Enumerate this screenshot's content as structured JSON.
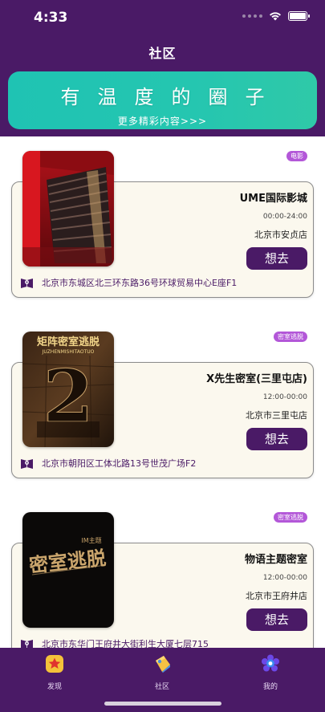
{
  "status": {
    "time": "4:33"
  },
  "nav": {
    "title": "社区"
  },
  "banner": {
    "title": "有温度的圈子",
    "subtitle": "更多精彩内容>>>",
    "color": "#1fc3b3"
  },
  "colors": {
    "brand": "#4a1a66",
    "tag": "#b357d8",
    "card_bg": "#fbf8ee"
  },
  "venues": [
    {
      "tag": "电影",
      "name": "UME国际影城",
      "hours": "00:00-24:00",
      "area": "北京市安贞店",
      "button": "想去",
      "address": "北京市东城区北三环东路36号环球贸易中心E座F1",
      "poster_icon": "cinema-poster"
    },
    {
      "tag": "密室逃脱",
      "name": "X先生密室(三里屯店)",
      "hours": "12:00-00:00",
      "area": "北京市三里屯店",
      "button": "想去",
      "address": "北京市朝阳区工体北路13号世茂广场F2",
      "poster_icon": "escape-room-poster",
      "poster_title": "矩阵密室逃脱",
      "poster_sub": "JUZHENMISHITAOTUO",
      "poster_num": "2"
    },
    {
      "tag": "密室逃脱",
      "name": "物语主题密室",
      "hours": "12:00-00:00",
      "area": "北京市王府井店",
      "button": "想去",
      "address": "北京市东华门王府井大街利生大厦七层715",
      "poster_icon": "escape-room-poster",
      "poster_title": "密室逃脱",
      "poster_sub": "IM主题"
    }
  ],
  "tabs": [
    {
      "label": "发现",
      "icon": "star-icon"
    },
    {
      "label": "社区",
      "icon": "community-icon"
    },
    {
      "label": "我的",
      "icon": "profile-icon"
    }
  ]
}
